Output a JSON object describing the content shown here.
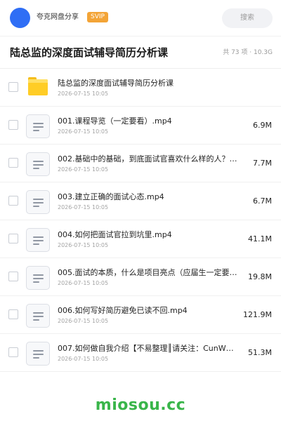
{
  "header": {
    "share_name": "夸克网盘分享",
    "badge": "SVIP",
    "search_label": "搜索",
    "avatar_color": "#2f6ef5"
  },
  "title_bar": {
    "title": "陆总监的深度面试辅导简历分析课",
    "summary": "共 73 项 · 10.3G"
  },
  "files": [
    {
      "type": "folder",
      "icon": "folder-icon",
      "name": "陆总监的深度面试辅导简历分析课",
      "date": "2026-07-15 10:05",
      "size": ""
    },
    {
      "type": "video",
      "icon": "file-icon",
      "name": "001.课程导览（一定要看）.mp4",
      "date": "2026-07-15 10:05",
      "size": "6.9M"
    },
    {
      "type": "video",
      "icon": "file-icon",
      "name": "002.基础中的基础，到底面试官喜欢什么样的人？【…",
      "date": "2026-07-15 10:05",
      "size": "7.7M"
    },
    {
      "type": "video",
      "icon": "file-icon",
      "name": "003.建立正确的面试心态.mp4",
      "date": "2026-07-15 10:05",
      "size": "6.7M"
    },
    {
      "type": "video",
      "icon": "file-icon",
      "name": "004.如何把面试官拉到坑里.mp4",
      "date": "2026-07-15 10:05",
      "size": "41.1M"
    },
    {
      "type": "video",
      "icon": "file-icon",
      "name": "005.面试的本质，什么是项目亮点（应届生一定要理…",
      "date": "2026-07-15 10:05",
      "size": "19.8M"
    },
    {
      "type": "video",
      "icon": "file-icon",
      "name": "006.如何写好简历避免已读不回.mp4",
      "date": "2026-07-15 10:05",
      "size": "121.9M"
    },
    {
      "type": "video",
      "icon": "file-icon",
      "name": "007.如何做自我介绍【不易整理║请关注：CunW…",
      "date": "2026-07-15 10:05",
      "size": "51.3M"
    }
  ],
  "watermark": "miosou.cc",
  "colors": {
    "badge": "#f3a437",
    "folder": "#ffcd26",
    "watermark": "#39b54a"
  }
}
